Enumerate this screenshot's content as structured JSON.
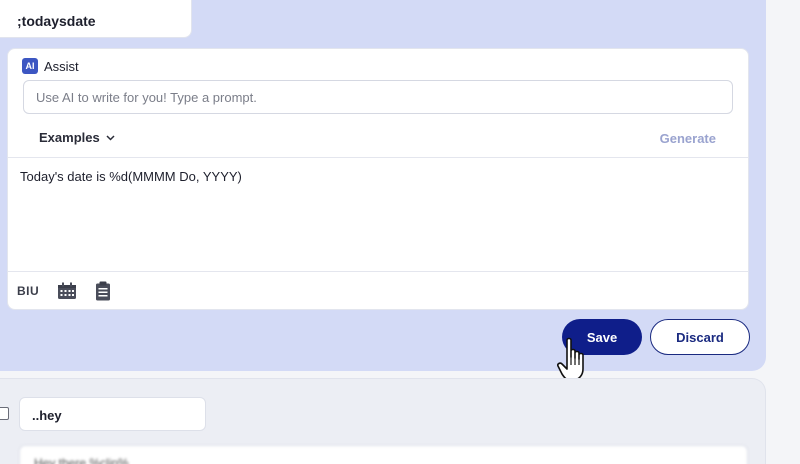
{
  "snippet": {
    "abbreviation": ";todaysdate",
    "assist": {
      "badge": "AI",
      "label": "Assist",
      "prompt_placeholder": "Use AI to write for you! Type a prompt.",
      "examples_label": "Examples",
      "generate_label": "Generate"
    },
    "content": "Today's date is %d(MMMM Do, YYYY)",
    "toolbar": {
      "format_label": "BIU",
      "icons": [
        "calendar-icon",
        "clipboard-icon"
      ]
    },
    "actions": {
      "save_label": "Save",
      "discard_label": "Discard"
    }
  },
  "next_snippet": {
    "abbreviation": "..hey",
    "preview": "Hey there %clip%"
  },
  "colors": {
    "panel_bg": "#d3daf6",
    "accent": "#0f1e8a",
    "generate_disabled": "#9aa3cf"
  }
}
